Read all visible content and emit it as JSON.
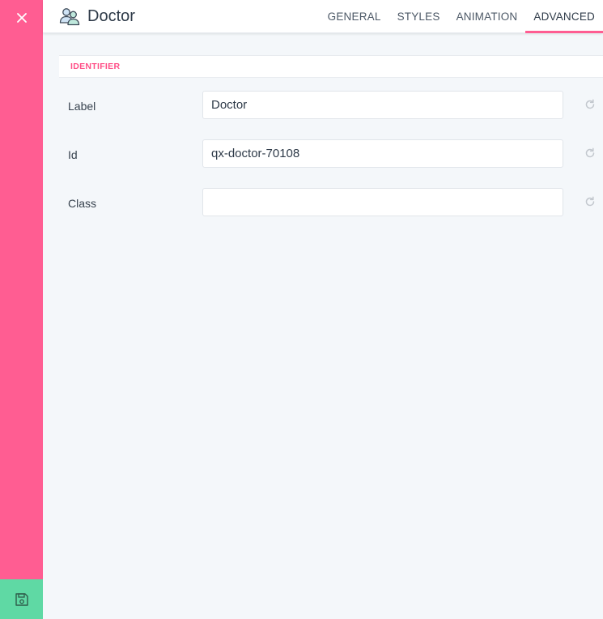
{
  "header": {
    "title": "Doctor",
    "title_icon": "doctor-icon",
    "tabs": [
      {
        "label": "GENERAL",
        "active": false
      },
      {
        "label": "STYLES",
        "active": false
      },
      {
        "label": "ANIMATION",
        "active": false
      },
      {
        "label": "ADVANCED",
        "active": true
      }
    ]
  },
  "sidebar": {
    "close_icon": "close-icon",
    "save_icon": "save-icon"
  },
  "section": {
    "title": "IDENTIFIER"
  },
  "fields": [
    {
      "label": "Label",
      "value": "Doctor",
      "reset_icon": "reset-icon"
    },
    {
      "label": "Id",
      "value": "qx-doctor-70108",
      "reset_icon": "reset-icon"
    },
    {
      "label": "Class",
      "value": "",
      "reset_icon": "reset-icon"
    }
  ],
  "colors": {
    "accent": "#ff5d92",
    "save": "#5fd9a4",
    "background": "#f4f7fa"
  }
}
